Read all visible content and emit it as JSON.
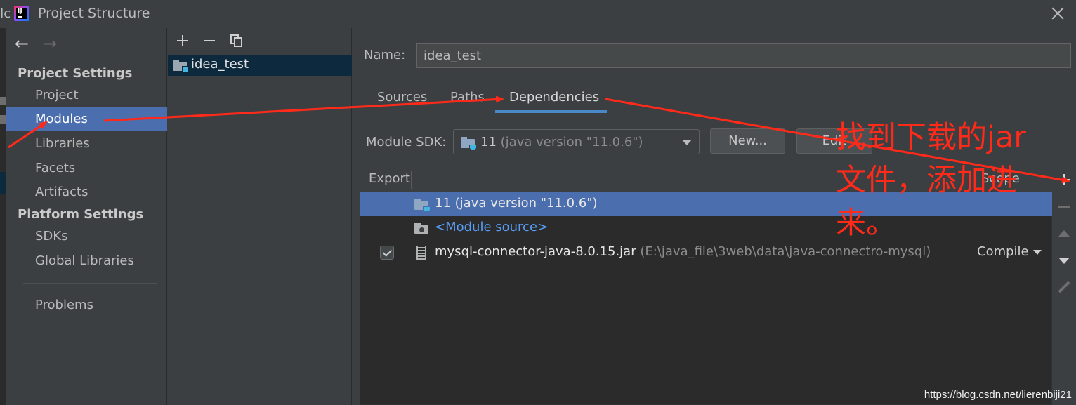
{
  "window": {
    "edge_text": "Ic",
    "title": "Project Structure"
  },
  "nav": {
    "sections": [
      {
        "label": "Project Settings",
        "items": [
          {
            "label": "Project"
          },
          {
            "label": "Modules",
            "selected": true
          },
          {
            "label": "Libraries"
          },
          {
            "label": "Facets"
          },
          {
            "label": "Artifacts"
          }
        ]
      },
      {
        "label": "Platform Settings",
        "items": [
          {
            "label": "SDKs"
          },
          {
            "label": "Global Libraries"
          }
        ]
      }
    ],
    "problems": "Problems"
  },
  "modules": {
    "list": [
      {
        "label": "idea_test",
        "selected": true
      }
    ]
  },
  "details": {
    "name_label": "Name:",
    "name_value": "idea_test",
    "tabs": [
      {
        "label": "Sources"
      },
      {
        "label": "Paths"
      },
      {
        "label": "Dependencies",
        "active": true
      }
    ],
    "sdk_label": "Module SDK:",
    "sdk_version": "11",
    "sdk_detail": "(java version \"11.0.6\")",
    "new_button": "New...",
    "edit_button": "Edit",
    "table": {
      "col_export": "Export",
      "col_scope": "Scope",
      "rows": [
        {
          "name": "11",
          "detail": "(java version \"11.0.6\")",
          "selected": true
        },
        {
          "name": "<Module source>"
        },
        {
          "name": "mysql-connector-java-8.0.15.jar",
          "detail": "(E:\\java_file\\3web\\data\\java-connectro-mysql)",
          "checked": true,
          "scope": "Compile"
        }
      ]
    }
  },
  "annotation": {
    "text": "找到下载的jar文件，添加进来。",
    "color": "#ff2a1a"
  },
  "watermark": "https://blog.csdn.net/lierenbiji21",
  "colors": {
    "background": "#3c3f41",
    "selection": "#4b6eaf",
    "tab_underline": "#4a88c7",
    "link": "#589df6"
  }
}
